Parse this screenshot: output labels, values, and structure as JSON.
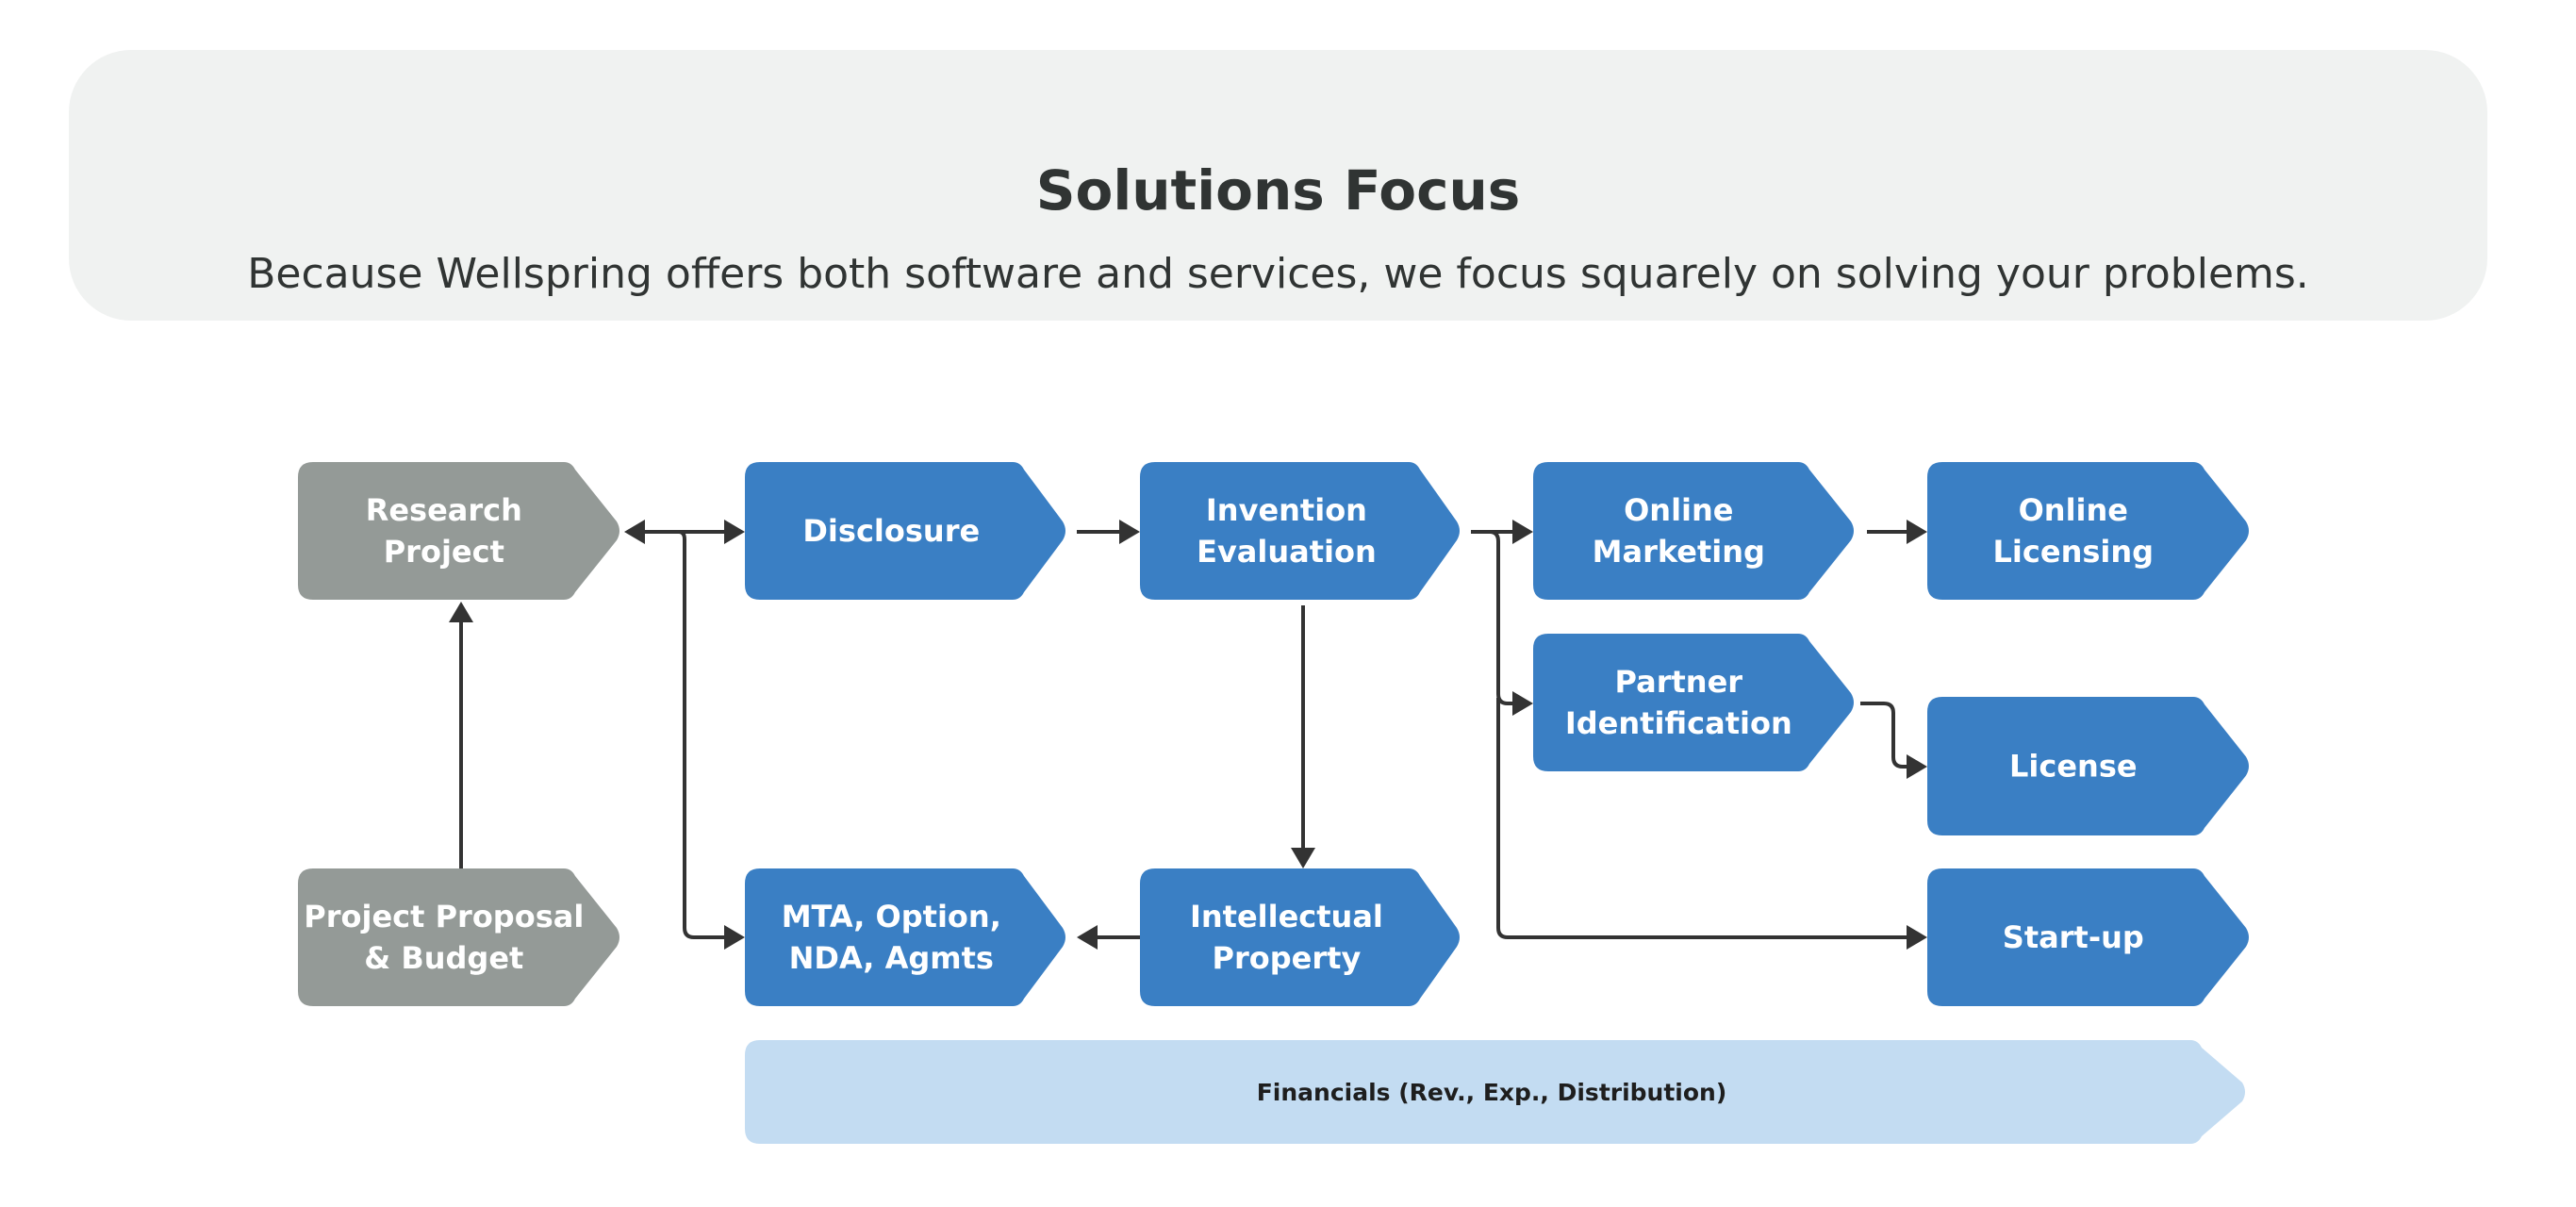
{
  "header": {
    "title": "Solutions Focus",
    "subtitle": "Because Wellspring offers both software and services, we focus squarely on solving your problems."
  },
  "colors": {
    "header_bg": "#f0f2f1",
    "text_dark": "#303433",
    "node_gray": "#949a97",
    "node_blue": "#3a7fc4",
    "node_light_blue": "#c3dcf2",
    "connector": "#333333"
  },
  "nodes": [
    {
      "id": "research-project",
      "lines": [
        "Research",
        "Project"
      ],
      "style": "gray"
    },
    {
      "id": "disclosure",
      "lines": [
        "Disclosure"
      ],
      "style": "blue"
    },
    {
      "id": "invention-evaluation",
      "lines": [
        "Invention",
        "Evaluation"
      ],
      "style": "blue"
    },
    {
      "id": "online-marketing",
      "lines": [
        "Online",
        "Marketing"
      ],
      "style": "blue"
    },
    {
      "id": "online-licensing",
      "lines": [
        "Online",
        "Licensing"
      ],
      "style": "blue"
    },
    {
      "id": "partner-identification",
      "lines": [
        "Partner",
        "Identification"
      ],
      "style": "blue"
    },
    {
      "id": "license",
      "lines": [
        "License"
      ],
      "style": "blue"
    },
    {
      "id": "project-proposal-budget",
      "lines": [
        "Project Proposal",
        "& Budget"
      ],
      "style": "gray"
    },
    {
      "id": "mta-option-nda-agmts",
      "lines": [
        "MTA, Option,",
        "NDA, Agmts"
      ],
      "style": "blue"
    },
    {
      "id": "intellectual-property",
      "lines": [
        "Intellectual",
        "Property"
      ],
      "style": "blue"
    },
    {
      "id": "start-up",
      "lines": [
        "Start-up"
      ],
      "style": "blue"
    },
    {
      "id": "financials",
      "lines": [
        "Financials (Rev., Exp., Distribution)"
      ],
      "style": "light"
    }
  ],
  "edges": [
    {
      "from": "project-proposal-budget",
      "to": "research-project"
    },
    {
      "from": "research-project",
      "to": "disclosure",
      "bidirectional": true
    },
    {
      "from": "research-project",
      "to": "mta-option-nda-agmts"
    },
    {
      "from": "disclosure",
      "to": "invention-evaluation"
    },
    {
      "from": "invention-evaluation",
      "to": "online-marketing"
    },
    {
      "from": "invention-evaluation",
      "to": "partner-identification"
    },
    {
      "from": "invention-evaluation",
      "to": "start-up"
    },
    {
      "from": "invention-evaluation",
      "to": "intellectual-property"
    },
    {
      "from": "online-marketing",
      "to": "online-licensing"
    },
    {
      "from": "partner-identification",
      "to": "license"
    },
    {
      "from": "intellectual-property",
      "to": "mta-option-nda-agmts"
    }
  ]
}
